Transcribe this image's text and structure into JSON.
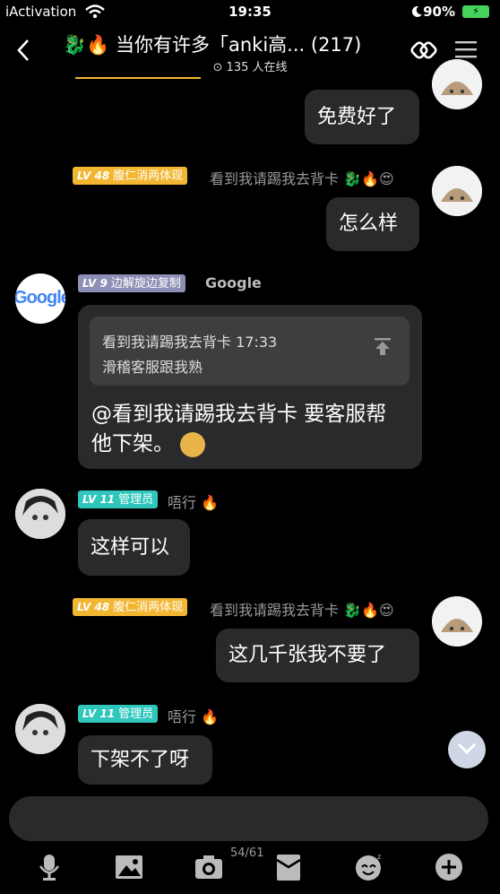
{
  "status_bar": {
    "carrier": "iActivation",
    "time": "19:35",
    "battery_percent": "90%"
  },
  "header": {
    "title": "当你有许多「anki高... (217)",
    "online": "135 人在线"
  },
  "messages": [
    {
      "text": "免费好了"
    },
    {
      "level": "LV 48",
      "title": "腹仁消两体现",
      "nick": "看到我请踢我去背卡",
      "text": "怎么样"
    },
    {
      "level": "LV 9",
      "title": "边解旋边复制",
      "nick": "Google",
      "quote_line1": "看到我请踢我去背卡 17:33",
      "quote_line2": "滑稽客服跟我熟",
      "text_line1": "@看到我请踢我去背卡 要客服帮",
      "text_line2": "他下架。"
    },
    {
      "level": "LV 11",
      "title": "管理员",
      "nick": "唔行",
      "text": "这样可以"
    },
    {
      "level": "LV 48",
      "title": "腹仁消两体现",
      "nick": "看到我请踢我去背卡",
      "text": "这几千张我不要了"
    },
    {
      "level": "LV 11",
      "title": "管理员",
      "nick": "唔行",
      "text": "下架不了呀"
    }
  ],
  "google_avatar_text": "Google",
  "toolbar": {
    "page_count": "54/61"
  },
  "colors": {
    "lv48_badge": "#f2b632",
    "lv9_badge": "#8d8fb5",
    "lv11_badge": "#2fc7bc",
    "bubble": "#2a2a2c",
    "background": "#000000"
  }
}
